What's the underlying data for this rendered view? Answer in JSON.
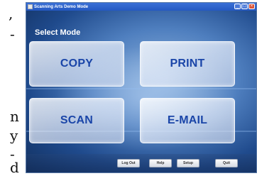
{
  "side_text": [
    ",",
    "-",
    "n",
    "y",
    "-",
    "d"
  ],
  "window": {
    "title": "Scanning Arts Demo Mode",
    "minimize_glyph": "_",
    "maximize_glyph": "□",
    "close_glyph": "×"
  },
  "main": {
    "heading": "Select Mode",
    "modes": {
      "copy": "COPY",
      "print": "PRINT",
      "scan": "SCAN",
      "email": "E-MAIL"
    }
  },
  "footer": {
    "logout": "Log Out",
    "help": "Help",
    "setup": "Setup",
    "quit": "Quit"
  },
  "colors": {
    "mode_text": "#1a45a8",
    "titlebar": "#2458c2",
    "background": "#1f4a8c"
  }
}
